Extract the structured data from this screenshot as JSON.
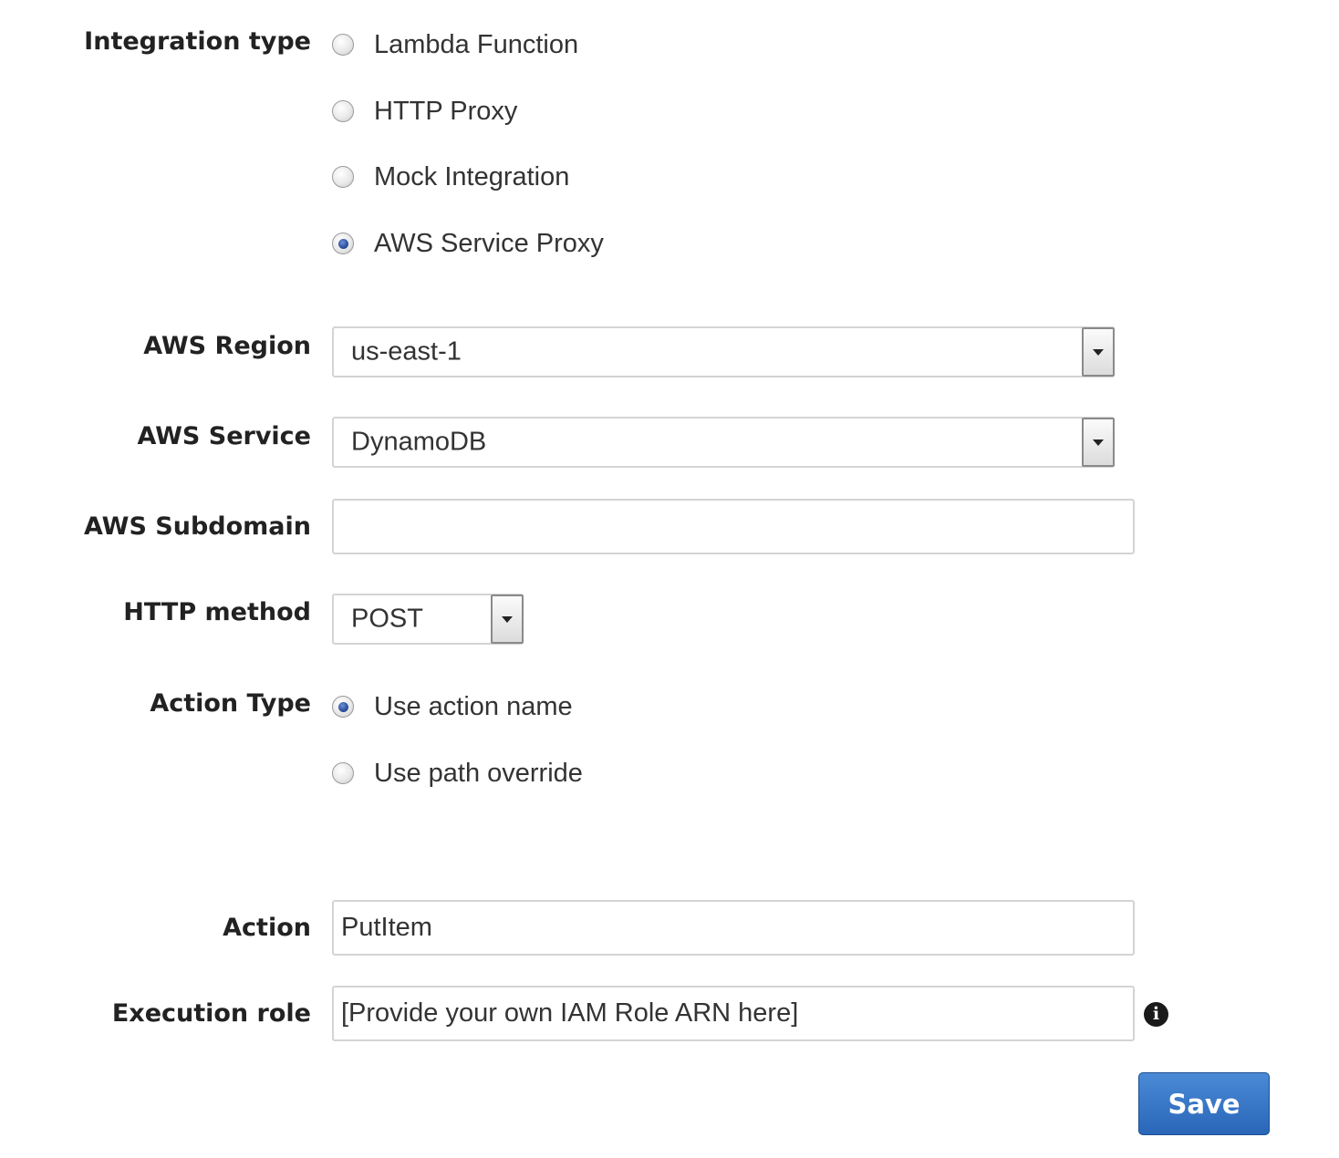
{
  "integration_type": {
    "label": "Integration type",
    "options": [
      {
        "label": "Lambda Function",
        "checked": false
      },
      {
        "label": "HTTP Proxy",
        "checked": false
      },
      {
        "label": "Mock Integration",
        "checked": false
      },
      {
        "label": "AWS Service Proxy",
        "checked": true
      }
    ]
  },
  "aws_region": {
    "label": "AWS Region",
    "value": "us-east-1"
  },
  "aws_service": {
    "label": "AWS Service",
    "value": "DynamoDB"
  },
  "aws_subdomain": {
    "label": "AWS Subdomain",
    "value": ""
  },
  "http_method": {
    "label": "HTTP method",
    "value": "POST"
  },
  "action_type": {
    "label": "Action Type",
    "options": [
      {
        "label": "Use action name",
        "checked": true
      },
      {
        "label": "Use path override",
        "checked": false
      }
    ]
  },
  "action": {
    "label": "Action",
    "value": "PutItem"
  },
  "execution_role": {
    "label": "Execution role",
    "value": "[Provide your own IAM Role ARN here]",
    "info_icon": "info-icon"
  },
  "save_button": {
    "label": "Save"
  },
  "colors": {
    "save_button_bg": "#2f6cbf",
    "radio_checked": "#2a4f9e",
    "label_text": "#222222",
    "body_text": "#333333",
    "input_border": "#d4d4d4"
  }
}
